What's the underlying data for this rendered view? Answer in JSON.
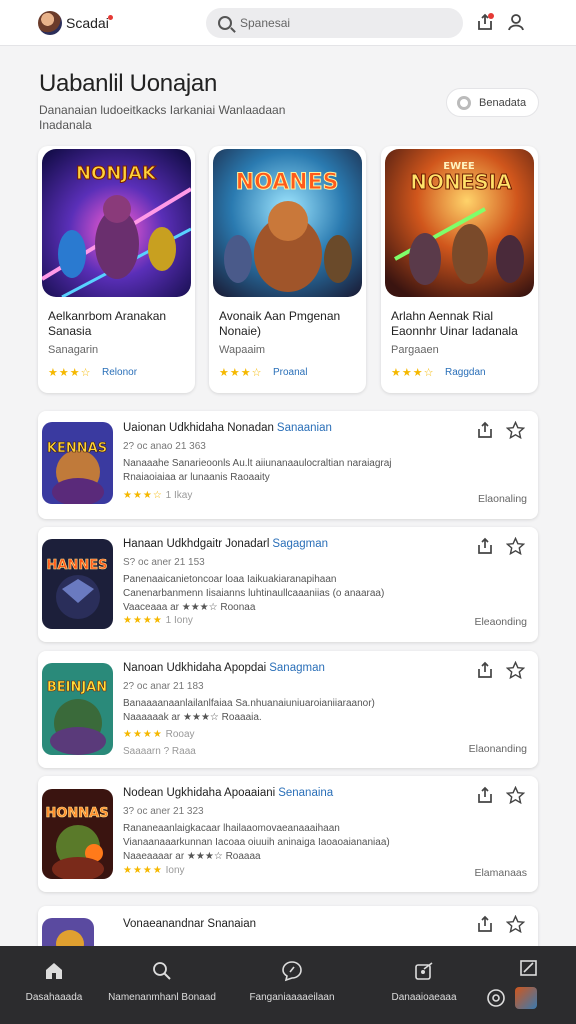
{
  "app": {
    "brand": "Scadai",
    "search_placeholder": "Spanesai"
  },
  "header": {
    "title": "Uabanlil Uonajan",
    "subtitle": "Dananaian ludoeitkacks Iarkaniai Wanlaadaan Inadanala",
    "action_button": "Benadata"
  },
  "featured": [
    {
      "art_title": "NONJAK",
      "title": "Aelkanrbom Aranakan Sanasia",
      "subtitle": "Sanagarin",
      "stars": "★★★☆",
      "link": "Relonor"
    },
    {
      "art_title": "NOANES",
      "title": "Avonaik Aan Pmgenan Nonaie)",
      "subtitle": "Wapaaim",
      "stars": "★★★☆",
      "link": "Proanal"
    },
    {
      "art_title": "NONESIA",
      "art_top": "EWEE",
      "title": "Arlahn Aennak Rial Eaonnhr Uinar Iadanala",
      "subtitle": "Pargaaen",
      "stars": "★★★☆",
      "link": "Raggdan"
    }
  ],
  "list": [
    {
      "art_title": "KENNAS",
      "title": "Uaionan Udkhidaha Nonadan",
      "tag": "Sanaanian",
      "date": "2? oc anao 21 363",
      "desc": [
        "Nanaaahe Sanarieoonls Au.lt aiiunanaaulocraltian naraiagraj",
        "Rnaiaoiaiaa ar lunaanis Raoaaity"
      ],
      "meta_stars": "★★★☆",
      "meta_text": "1 Ikay",
      "label": "Elaonaling"
    },
    {
      "art_title": "HANNES",
      "title": "Hanaan Udkhdgaitr Jonadarl",
      "tag": "Sagagman",
      "date": "S? oc aner 21 153",
      "desc": [
        "Panenaaicanietoncoar loaa Iaikuakiaranapihaan",
        "Canenarbanmenn Iisaianns luhtinaullcaaaniias (o anaaraa)",
        "Vaaceaaa ar ★★★☆ Roonaa"
      ],
      "meta_stars": "★★★★",
      "meta_text": "1 Iony",
      "label": "Eleaonding"
    },
    {
      "art_title": "BEINJAN",
      "title": "Nanoan Udkhidaha Apopdai",
      "tag": "Sanagman",
      "date": "2? oc anar 21 183",
      "desc": [
        "Banaaaanaanlailanlfaiaa Sa.nhuanaiuniuaroianiiaraanor)",
        "Naaaaaak ar ★★★☆ Roaaaia."
      ],
      "meta_stars": "★★★★",
      "meta_text": "Rooay",
      "meta2": "Saaaarn ? Raaa",
      "label": "Elaonanding"
    },
    {
      "art_title": "HONNAS",
      "title": "Nodean Ugkhidaha Apoaaiani",
      "tag": "Senanaina",
      "date": "3? oc aner 21 323",
      "desc": [
        "Rananeaanlaigkacaar lhailaaomovaeanaaaihaan",
        "Vianaanaaarkunnan Iacoaa oiuuih aninaiga Iaoaoaiananiaa)",
        "Naaeaaaar ar ★★★☆ Roaaaa"
      ],
      "meta_stars": "★★★★",
      "meta_text": "Iony",
      "label": "Elamanaas"
    },
    {
      "title": "Vonaeanandnar Snanaian"
    }
  ],
  "bottom_nav": [
    "Dasahaaada",
    "Namenanmhanl Bonaad",
    "Fanganiaaaaeilaan",
    "Danaaioaeaaa"
  ],
  "colors": {
    "accent": "#2a6fb8",
    "star": "#f5b800",
    "nav_bg": "#2c2c2e"
  }
}
